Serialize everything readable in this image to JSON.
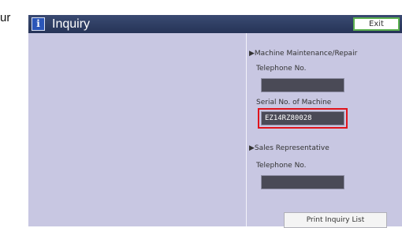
{
  "cutoff_text": "ur",
  "header": {
    "icon_glyph": "i",
    "title": "Inquiry",
    "exit_label": "Exit"
  },
  "maintenance": {
    "heading": "Machine Maintenance/Repair",
    "telephone_label": "Telephone No.",
    "telephone_value": "",
    "serial_label": "Serial No. of Machine",
    "serial_value": "EZ14RZ80028"
  },
  "sales": {
    "heading": "Sales Representative",
    "telephone_label": "Telephone No.",
    "telephone_value": ""
  },
  "print_button_label": "Print Inquiry List",
  "colors": {
    "title_bar": "#2b3a60",
    "content_bg": "#c8c7e2",
    "field_bg": "#4a4a56",
    "exit_border": "#5cb050",
    "highlight": "#e0141c"
  }
}
